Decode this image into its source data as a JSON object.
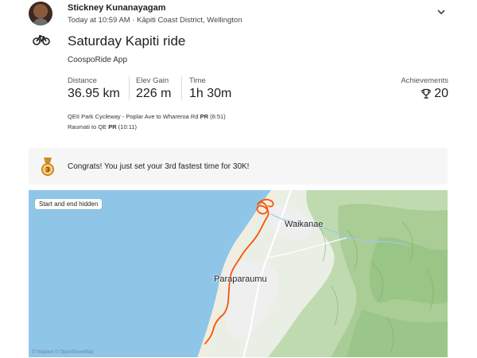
{
  "athlete": {
    "name": "Stickney Kunanayagam",
    "meta": "Today at 10:59 AM · Kāpiti Coast District, Wellington"
  },
  "activity": {
    "title": "Saturday Kapiti ride",
    "app": "CoospoRide App",
    "sport_icon": "bike-icon"
  },
  "stats": [
    {
      "label": "Distance",
      "value": "36.95 km"
    },
    {
      "label": "Elev Gain",
      "value": "226 m"
    },
    {
      "label": "Time",
      "value": "1h 30m"
    }
  ],
  "achievements": {
    "label": "Achievements",
    "value": "20",
    "icon": "trophy-icon"
  },
  "segments": [
    {
      "text": "QEII Park Cycleway - Poplar Ave to Whareroa Rd",
      "badge": "PR",
      "time": "(6:51)"
    },
    {
      "text": "Raumati to QE",
      "badge": "PR",
      "time": "(10:11)"
    }
  ],
  "congrats": {
    "text": "Congrats! You just set your 3rd fastest time for 30K!",
    "icon": "medal-icon"
  },
  "map": {
    "pill": "Start and end hidden",
    "places": [
      "Waikanae",
      "Paraparaumu"
    ],
    "attribution": "© Mapbox © OpenStreetMap",
    "route_color": "#fc5200",
    "sea_color": "#8fc6e8",
    "land_color": "#e9efe4"
  }
}
